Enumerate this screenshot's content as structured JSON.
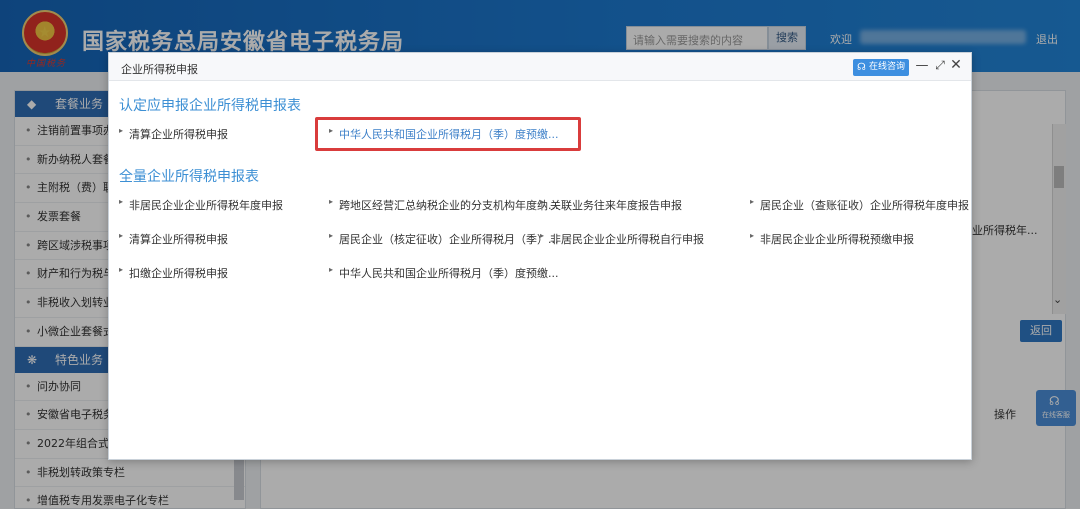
{
  "header": {
    "logo_script": "中国税务",
    "site_title": "国家税务总局安徽省电子税务局",
    "search_placeholder": "请输入需要搜索的内容",
    "search_button": "搜索",
    "welcome": "欢迎",
    "logout": "退出"
  },
  "sidebar": {
    "sections": [
      {
        "title": "套餐业务",
        "items": [
          "注销前置事项办",
          "新办纳税人套餐",
          "主附税（费）联",
          "发票套餐",
          "跨区域涉税事项",
          "财产和行为税与",
          "非税收入划转业",
          "小微企业套餐式"
        ]
      },
      {
        "title": "特色业务",
        "items": [
          "问办协同",
          "安徽省电子税务",
          "2022年组合式税",
          "非税划转政策专栏",
          "增值税专用发票电子化专栏"
        ]
      }
    ]
  },
  "background": {
    "fragment_text": "业所得税年...",
    "back_button": "返回",
    "operation_label": "操作",
    "float_consult": "在线客服"
  },
  "modal": {
    "title": "企业所得税申报",
    "consult_button": "在线咨询",
    "section1_title": "认定应申报企业所得税申报表",
    "section1_links": [
      "清算企业所得税申报",
      "中华人民共和国企业所得税月（季）度预缴..."
    ],
    "section2_title": "全量企业所得税申报表",
    "section2_links": [
      "非居民企业企业所得税年度申报",
      "跨地区经营汇总纳税企业的分支机构年度纳...",
      "关联业务往来年度报告申报",
      "居民企业（查账征收）企业所得税年度申报",
      "清算企业所得税申报",
      "居民企业（核定征收）企业所得税月（季）...",
      "非居民企业企业所得税自行申报",
      "非居民企业企业所得税预缴申报",
      "扣缴企业所得税申报",
      "中华人民共和国企业所得税月（季）度预缴..."
    ]
  }
}
